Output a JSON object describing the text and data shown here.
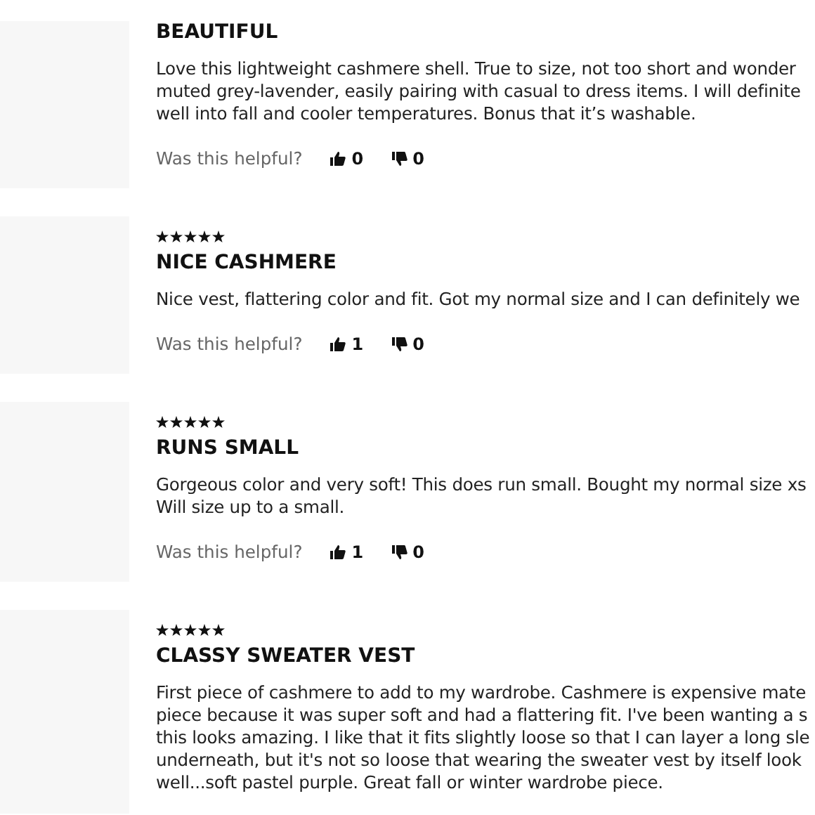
{
  "reviews": [
    {
      "title": "BEAUTIFUL",
      "body": [
        "Love this lightweight cashmere shell. True to size, not too short and wonder",
        "muted grey-lavender, easily pairing with casual to dress items. I will definite",
        "well into fall and cooler temperatures. Bonus that it’s washable."
      ],
      "helpful": {
        "label": "Was this helpful?",
        "up": "0",
        "down": "0"
      }
    },
    {
      "stars": 5,
      "title": "NICE CASHMERE",
      "body": [
        "Nice vest, flattering color and fit. Got my normal size and I can definitely we"
      ],
      "helpful": {
        "label": "Was this helpful?",
        "up": "1",
        "down": "0"
      }
    },
    {
      "stars": 5,
      "title": "RUNS SMALL",
      "body": [
        "Gorgeous color and very soft! This does run small. Bought my normal size xs",
        "Will size up to a small."
      ],
      "helpful": {
        "label": "Was this helpful?",
        "up": "1",
        "down": "0"
      }
    },
    {
      "stars": 5,
      "title": "CLASSY SWEATER VEST",
      "body": [
        "First piece of cashmere to add to my wardrobe. Cashmere is expensive mate",
        "piece because it was super soft and had a flattering fit. I've been wanting a s",
        "this looks amazing. I like that it fits slightly loose so that I can layer a long sle",
        "underneath, but it's not so loose that wearing the sweater vest by itself look",
        "well...soft pastel purple. Great fall or winter wardrobe piece."
      ]
    }
  ]
}
